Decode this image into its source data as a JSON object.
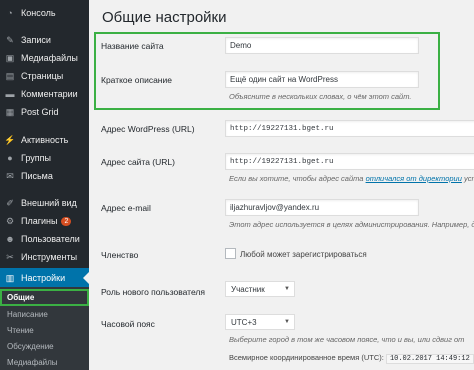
{
  "sidebar": {
    "items": [
      {
        "label": "Консоль",
        "icon": "dashboard-icon",
        "glyph": "◔"
      },
      {
        "label": "Записи",
        "icon": "pin-icon",
        "glyph": "✎"
      },
      {
        "label": "Медиафайлы",
        "icon": "media-icon",
        "glyph": "▣"
      },
      {
        "label": "Страницы",
        "icon": "pages-icon",
        "glyph": "▤"
      },
      {
        "label": "Комментарии",
        "icon": "comments-icon",
        "glyph": "▬"
      },
      {
        "label": "Post Grid",
        "icon": "grid-icon",
        "glyph": "▦"
      },
      {
        "label": "Активность",
        "icon": "activity-icon",
        "glyph": "⚡"
      },
      {
        "label": "Группы",
        "icon": "groups-icon",
        "glyph": "●"
      },
      {
        "label": "Письма",
        "icon": "mail-icon",
        "glyph": "✉"
      },
      {
        "label": "Внешний вид",
        "icon": "appearance-icon",
        "glyph": "✐"
      },
      {
        "label": "Плагины",
        "icon": "plugins-icon",
        "glyph": "⚙",
        "badge": "2"
      },
      {
        "label": "Пользователи",
        "icon": "users-icon",
        "glyph": "☻"
      },
      {
        "label": "Инструменты",
        "icon": "tools-icon",
        "glyph": "✂"
      },
      {
        "label": "Настройки",
        "icon": "settings-icon",
        "glyph": "▥"
      }
    ],
    "submenu": [
      "Общие",
      "Написание",
      "Чтение",
      "Обсуждение",
      "Медиафайлы"
    ]
  },
  "page": {
    "title": "Общие настройки"
  },
  "fields": {
    "site_title": {
      "label": "Название сайта",
      "value": "Demo"
    },
    "tagline": {
      "label": "Краткое описание",
      "value": "Ещё один сайт на WordPress",
      "desc": "Объясните в нескольких словах, о чём этот сайт."
    },
    "wp_address": {
      "label": "Адрес WordPress (URL)",
      "value": "http://19227131.bget.ru"
    },
    "site_address": {
      "label": "Адрес сайта (URL)",
      "value": "http://19227131.bget.ru",
      "desc_pre": "Если вы хотите, чтобы адрес сайта ",
      "desc_link1": "отличался от директории",
      "desc_end": " устан"
    },
    "email": {
      "label": "Адрес e-mail",
      "value": "iljazhuravljov@yandex.ru",
      "desc": "Этот адрес используется в целях администрирования. Например, для"
    },
    "membership": {
      "label": "Членство",
      "checkbox_label": "Любой может зарегистрироваться"
    },
    "default_role": {
      "label": "Роль нового пользователя",
      "value": "Участник"
    },
    "timezone": {
      "label": "Часовой пояс",
      "value": "UTC+3",
      "desc": "Выберите город в том же часовом поясе, что и вы, или сдвиг от",
      "utc_label": "Всемирное координированное время (UTC):",
      "utc_value": "10.02.2017 14:49:12"
    }
  }
}
